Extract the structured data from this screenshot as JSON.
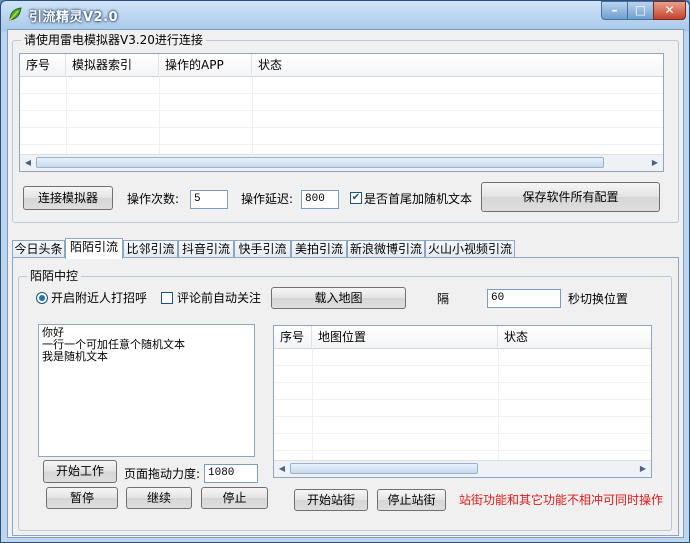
{
  "window": {
    "title": "引流精灵V2.0",
    "min": "–",
    "max": "□",
    "close": "✕"
  },
  "emulator": {
    "group_title": "请使用雷电模拟器V3.20进行连接",
    "columns": [
      "序号",
      "模拟器索引",
      "操作的APP",
      "状态"
    ],
    "connect_label": "连接模拟器",
    "op_count_label": "操作次数:",
    "op_count_value": "5",
    "op_delay_label": "操作延迟:",
    "op_delay_value": "800",
    "random_text_label": "是否首尾加随机文本",
    "random_text_checked": true,
    "save_config_label": "保存软件所有配置"
  },
  "tabs": [
    "今日头条",
    "陌陌引流",
    "比邻引流",
    "抖音引流",
    "快手引流",
    "美拍引流",
    "新浪微博引流",
    "火山小视频引流"
  ],
  "active_tab": 1,
  "momo": {
    "group_title": "陌陌中控",
    "nearby_label": "开启附近人打招呼",
    "follow_label": "评论前自动关注",
    "load_map_label": "载入地图",
    "interval_prefix": "隔",
    "interval_value": "60",
    "interval_suffix": "秒切换位置",
    "memo_lines": [
      "你好",
      "一行一个可加任意个随机文本",
      "我是随机文本"
    ],
    "map_columns": [
      "序号",
      "地图位置",
      "状态"
    ],
    "start_label": "开始工作",
    "drag_label": "页面拖动力度:",
    "drag_value": "1080",
    "pause_label": "暂停",
    "continue_label": "继续",
    "stop_label": "停止",
    "start_station_label": "开始站街",
    "stop_station_label": "停止站街",
    "warning": "站街功能和其它功能不相冲可同时操作"
  }
}
